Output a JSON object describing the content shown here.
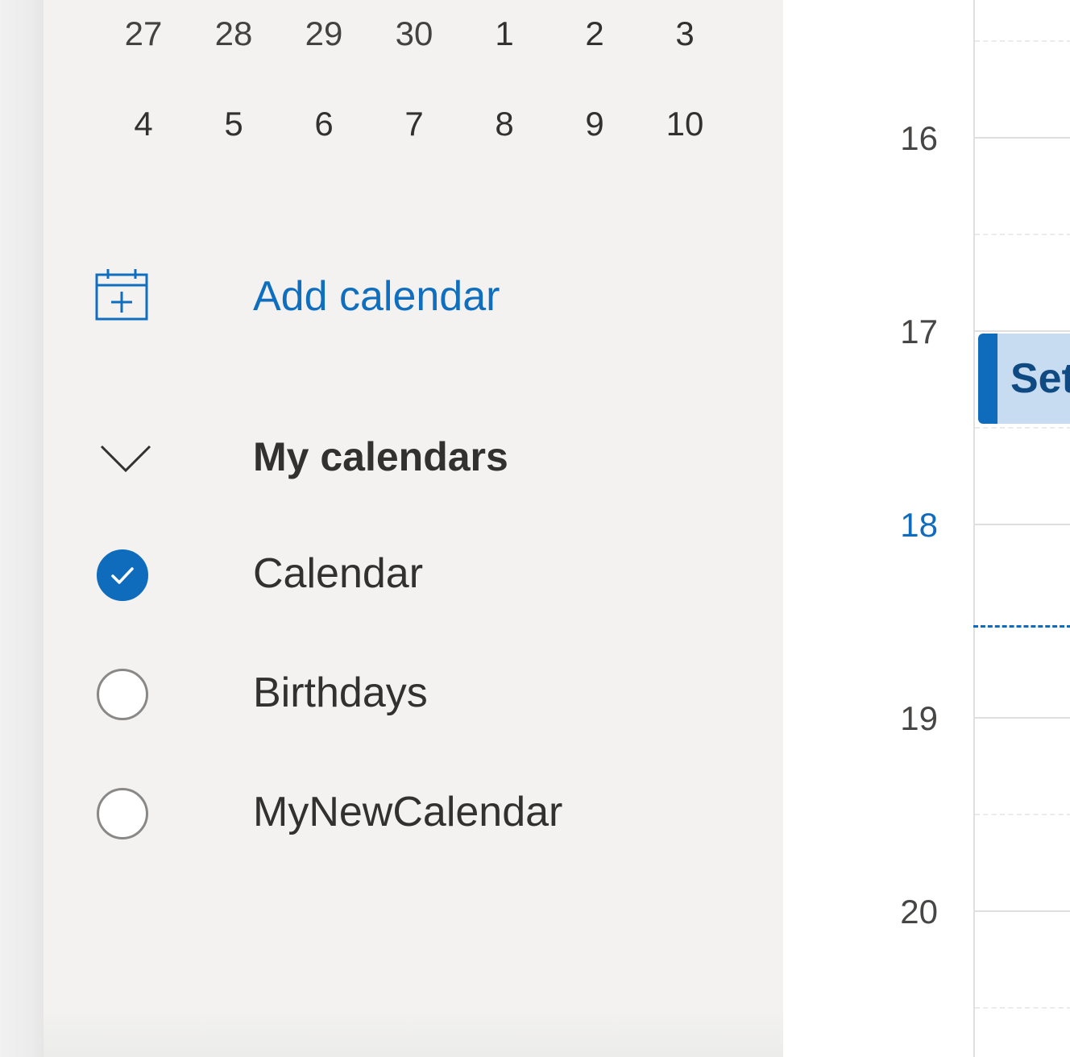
{
  "mini_calendar": {
    "rows": [
      [
        "27",
        "28",
        "29",
        "30",
        "1",
        "2",
        "3"
      ],
      [
        "4",
        "5",
        "6",
        "7",
        "8",
        "9",
        "10"
      ]
    ]
  },
  "sidebar": {
    "add_calendar_label": "Add calendar",
    "my_calendars_label": "My calendars",
    "calendars": [
      {
        "label": "Calendar",
        "checked": true
      },
      {
        "label": "Birthdays",
        "checked": false
      },
      {
        "label": "MyNewCalendar",
        "checked": false
      }
    ]
  },
  "time_grid": {
    "hours": [
      "16",
      "17",
      "18",
      "19",
      "20"
    ],
    "current_hour": "18",
    "event_title": "Set"
  },
  "colors": {
    "accent": "#0f6cbd",
    "link": "#106ebe",
    "event_fill": "#c7dcf0",
    "sidebar_bg": "#f3f2f1"
  },
  "icons": {
    "add_calendar": "calendar-add-icon",
    "group_toggle": "chevron-down-icon",
    "checked": "checkmark-icon"
  }
}
